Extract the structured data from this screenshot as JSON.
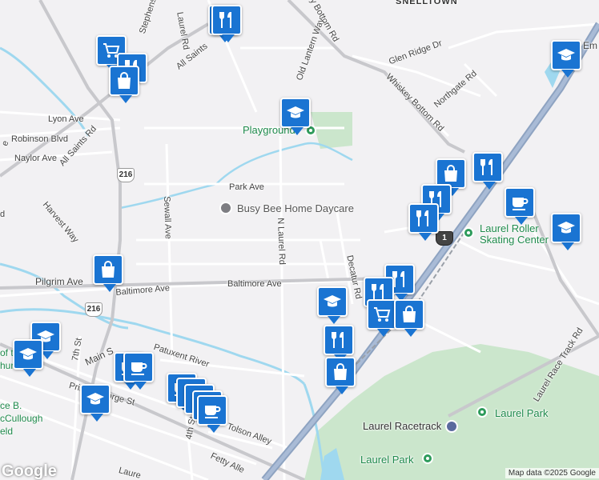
{
  "places": {
    "snelltown": "SNELLTOWN",
    "playground": "Playground",
    "daycare": "Busy Bee Home Daycare",
    "skating_1": "Laurel Roller",
    "skating_2": "Skating Center",
    "racetrack": "Laurel Racetrack",
    "park1": "Laurel Park",
    "park2": "Laurel Park"
  },
  "streets": {
    "laurel_rd": "Laurel Rd",
    "stephens": "Stephens",
    "all_saints_1": "All Saints",
    "all_saints_2": "All Saints Rd",
    "bottom_rd": "y Bottom Rd",
    "old_lantern": "Old Lantern Way",
    "glen_ridge": "Glen Ridge Dr",
    "whiskey_bottom": "Whiskey Bottom Rd",
    "northgate": "Northgate Rd",
    "lyon": "Lyon Ave",
    "robinson": "Robinson Blvd",
    "naylor": "Naylor Ave",
    "park_ave": "Park Ave",
    "harvest": "Harvest Way",
    "sewall": "Sewall Ave",
    "n_laurel": "N Laurel Rd",
    "decatur": "Decatur Rd",
    "pilgrim": "Pilgrim Ave",
    "baltimore_1": "Baltimore Ave",
    "baltimore_2": "Baltimore Ave",
    "seventh": "7th St",
    "main": "Main S",
    "patuxent": "Patuxent River",
    "prince_george": "Prince George St",
    "fourth": "4th St",
    "tolson": "Tolson Alley",
    "fetty": "Fetty Alle",
    "race_track": "Laurel Race Track Rd",
    "em": "Em",
    "left_e": "e",
    "left_d": "d",
    "of_the": "of th",
    "church": "hurc",
    "ce_b": "ce B.",
    "mcc": "cCullough",
    "eld": "eld",
    "laure": "Laure",
    "ne": "e"
  },
  "shields": {
    "r216a": "216",
    "r216b": "216",
    "us1": "1"
  },
  "icons": [
    "restaurant-icon",
    "school-icon",
    "shopping-cart-icon",
    "shopping-bag-icon",
    "cafe-icon"
  ],
  "colors": {
    "pin": "#1a74d2",
    "highway": "#8ea3c1",
    "water": "#9fd8ef",
    "park": "#cbe6cc",
    "green_poi": "#2e9b5b"
  },
  "footer": {
    "google": "Google",
    "attribution": "Map data ©2025 Google"
  }
}
